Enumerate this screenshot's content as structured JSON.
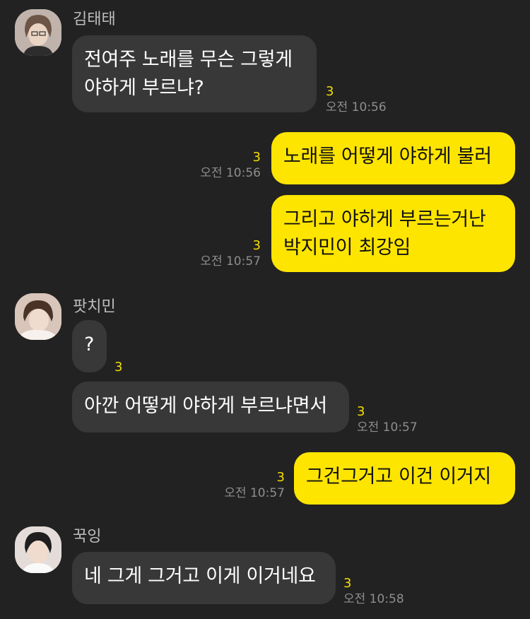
{
  "messages": [
    {
      "sender": "김태태",
      "text": "전여주 노래를 무슨 그렇게\n야하게 부르냐?",
      "unread": "3",
      "time": "오전 10:56"
    },
    {
      "text": "노래를 어떻게 야하게 불러",
      "unread": "3",
      "time": "오전 10:56"
    },
    {
      "text": "그리고 야하게 부르는거난\n박지민이 최강임",
      "unread": "3",
      "time": "오전 10:57"
    },
    {
      "sender": "팟치민",
      "text": "?",
      "unread": "3"
    },
    {
      "text": "아깐 어떻게 야하게 부르냐면서",
      "unread": "3",
      "time": "오전 10:57"
    },
    {
      "text": "그건그거고 이건 이거지",
      "unread": "3",
      "time": "오전 10:57"
    },
    {
      "sender": "꾹잉",
      "text": "네 그게 그거고 이게 이거네요",
      "unread": "3",
      "time": "오전 10:58"
    }
  ],
  "colors": {
    "background": "#222222",
    "incoming_bubble": "#383838",
    "outgoing_bubble": "#fee500",
    "unread_count": "#f4de00",
    "timestamp": "#8e8e8e"
  }
}
